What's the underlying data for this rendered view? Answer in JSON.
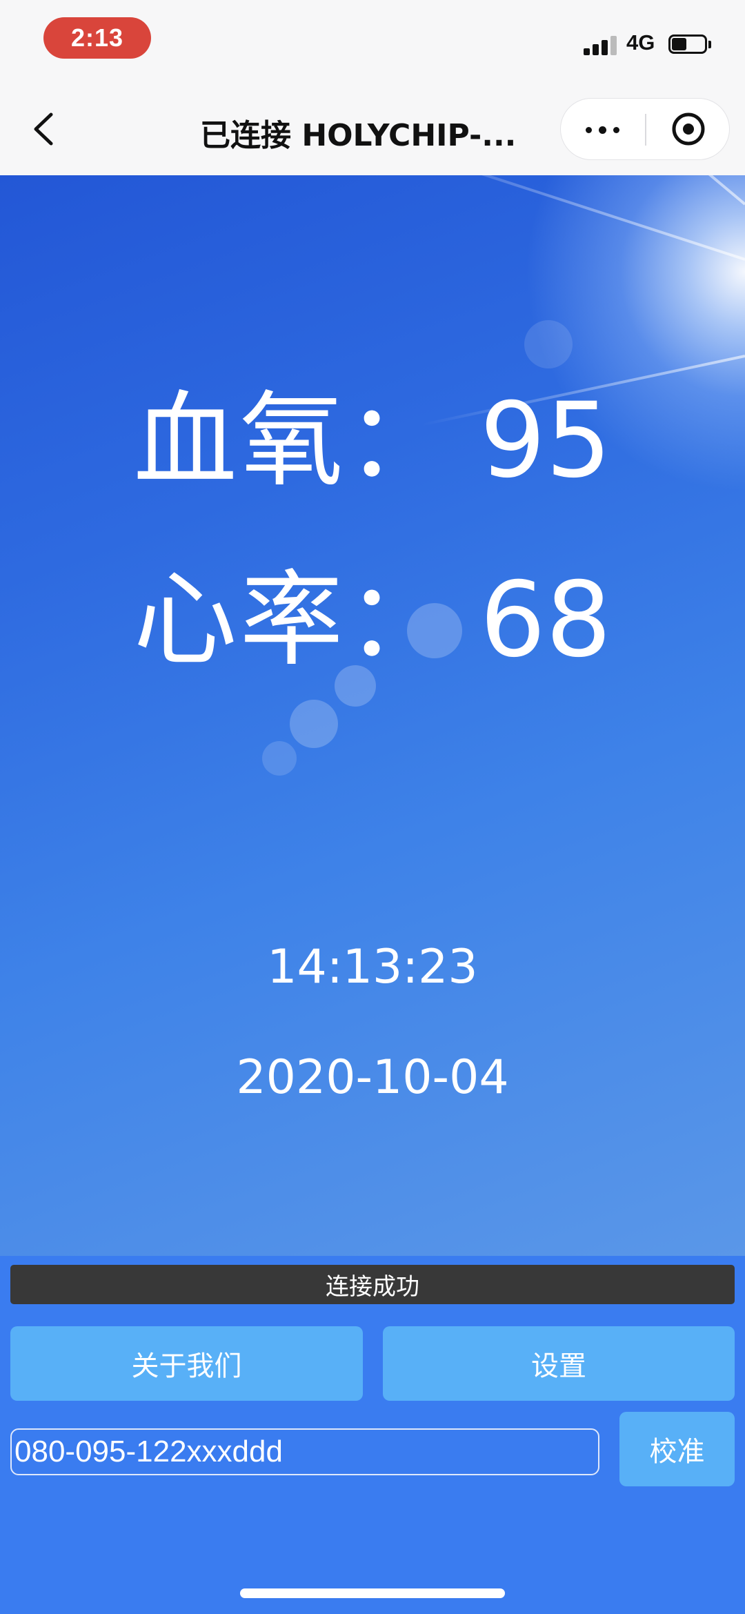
{
  "status_bar": {
    "time": "2:13",
    "network": "4G",
    "signal_bars_active": 3,
    "signal_bars_total": 4,
    "battery_level": 0.45
  },
  "nav": {
    "back_icon": "chevron-left-icon",
    "title": "已连接 HOLYCHIP-...",
    "more_icon": "more-dots-icon",
    "target_icon": "target-icon"
  },
  "readings": {
    "spo2": {
      "label": "血氧：",
      "value": "95"
    },
    "heart_rate": {
      "label": "心率：",
      "value": "68"
    }
  },
  "clock": {
    "time": "14:13:23",
    "date": "2020-10-04"
  },
  "panel": {
    "status_text": "连接成功",
    "about_button": "关于我们",
    "settings_button": "设置",
    "input_value": "080-095-122xxxddd",
    "calibrate_button": "校准"
  },
  "colors": {
    "time_pill": "#d9453b",
    "panel_background": "#3a7cf0",
    "button": "#58b0f7",
    "status_strip": "#383838"
  }
}
